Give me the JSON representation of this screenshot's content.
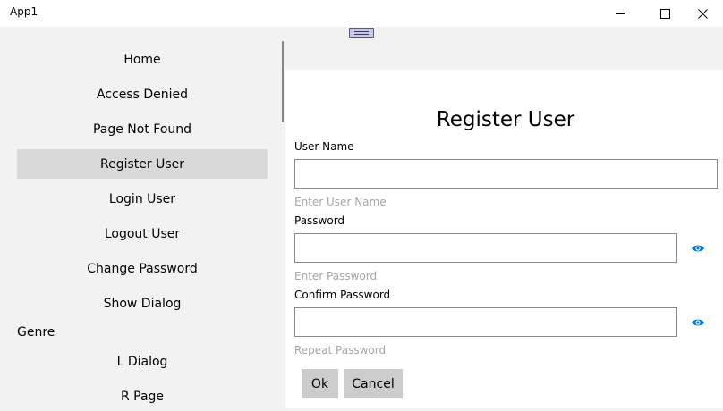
{
  "window": {
    "title": "App1",
    "minimize_icon": "minimize-icon",
    "maximize_icon": "maximize-icon",
    "close_icon": "close-icon"
  },
  "nav": {
    "items": [
      {
        "label": "Home"
      },
      {
        "label": "Access Denied"
      },
      {
        "label": "Page Not Found"
      },
      {
        "label": "Register User",
        "selected": true
      },
      {
        "label": "Login User"
      },
      {
        "label": "Logout User"
      },
      {
        "label": "Change Password"
      },
      {
        "label": "Show Dialog"
      }
    ],
    "group_header": "Genre",
    "group_items": [
      {
        "label": "L Dialog"
      },
      {
        "label": "R Page"
      }
    ]
  },
  "form": {
    "title": "Register User",
    "username": {
      "label": "User Name",
      "value": "",
      "hint": "Enter User Name"
    },
    "password": {
      "label": "Password",
      "value": "",
      "hint": "Enter Password",
      "reveal_icon": "eye-icon"
    },
    "confirm": {
      "label": "Confirm Password",
      "value": "",
      "hint": "Repeat Password",
      "reveal_icon": "eye-icon"
    },
    "ok_label": "Ok",
    "cancel_label": "Cancel"
  },
  "colors": {
    "accent": "#0078d7",
    "selected_background": "#d9d9d9",
    "button_background": "#cccccc",
    "hint_text": "#a6a6a6"
  }
}
